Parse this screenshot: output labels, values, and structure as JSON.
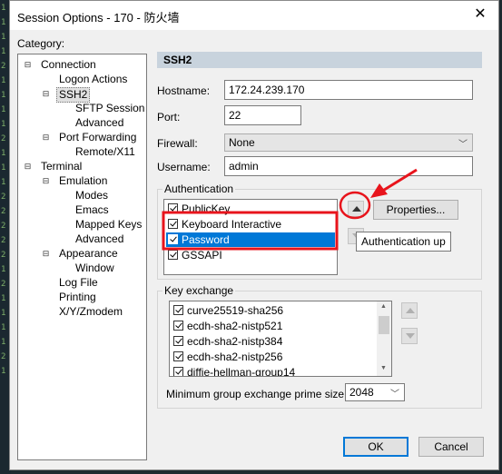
{
  "console": {
    "glyphs": [
      "1",
      "1",
      "1",
      "1",
      "2",
      "1",
      "1",
      "1",
      "1",
      "2",
      "1",
      "1",
      "1",
      "2",
      "2",
      "2",
      "2",
      "2",
      "1",
      "2",
      "1",
      "1",
      "1",
      "1",
      "2",
      "1"
    ]
  },
  "window": {
    "title": "Session Options - 170 - 防火墙",
    "close_glyph": "✕"
  },
  "category": {
    "label": "Category:",
    "items": [
      {
        "label": "Connection",
        "expander": "⊟"
      },
      {
        "label": "Logon Actions"
      },
      {
        "label": "SSH2",
        "expander": "⊟"
      },
      {
        "label": "SFTP Session"
      },
      {
        "label": "Advanced"
      },
      {
        "label": "Port Forwarding",
        "expander": "⊟"
      },
      {
        "label": "Remote/X11"
      },
      {
        "label": "Terminal",
        "expander": "⊟"
      },
      {
        "label": "Emulation",
        "expander": "⊟"
      },
      {
        "label": "Modes"
      },
      {
        "label": "Emacs"
      },
      {
        "label": "Mapped Keys"
      },
      {
        "label": "Advanced"
      },
      {
        "label": "Appearance",
        "expander": "⊟"
      },
      {
        "label": "Window"
      },
      {
        "label": "Log File"
      },
      {
        "label": "Printing"
      },
      {
        "label": "X/Y/Zmodem"
      }
    ],
    "selected": "SSH2"
  },
  "ssh2": {
    "header": "SSH2",
    "hostname_label": "Hostname:",
    "hostname": "172.24.239.170",
    "port_label": "Port:",
    "port": "22",
    "firewall_label": "Firewall:",
    "firewall": "None",
    "username_label": "Username:",
    "username": "admin"
  },
  "auth": {
    "group_label": "Authentication",
    "methods": [
      {
        "label": "PublicKey",
        "checked": true
      },
      {
        "label": "Keyboard Interactive",
        "checked": true
      },
      {
        "label": "Password",
        "checked": true
      },
      {
        "label": "GSSAPI",
        "checked": true
      }
    ],
    "properties_button": "Properties...",
    "tooltip": "Authentication up"
  },
  "kex": {
    "group_label": "Key exchange",
    "items": [
      {
        "label": "curve25519-sha256",
        "checked": true
      },
      {
        "label": "ecdh-sha2-nistp521",
        "checked": true
      },
      {
        "label": "ecdh-sha2-nistp384",
        "checked": true
      },
      {
        "label": "ecdh-sha2-nistp256",
        "checked": true
      },
      {
        "label": "diffie-hellman-group14",
        "checked": true
      }
    ],
    "min_group_label": "Minimum group exchange prime size:",
    "min_group_value": "2048"
  },
  "buttons": {
    "ok": "OK",
    "cancel": "Cancel"
  },
  "colors": {
    "highlight": "#0078d7",
    "annotation": "#e8141c",
    "header_bg": "#c8d3dd"
  }
}
